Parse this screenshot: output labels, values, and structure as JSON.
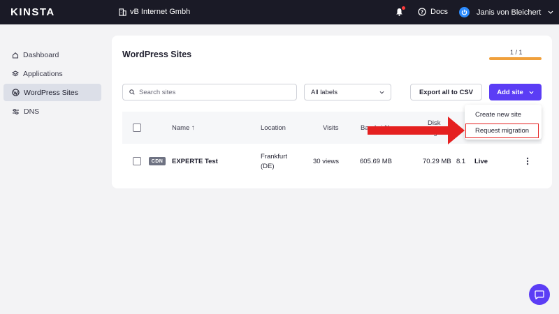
{
  "header": {
    "logo": "KINSTA",
    "company": "vB Internet Gmbh",
    "docs_label": "Docs",
    "user_name": "Janis von Bleichert"
  },
  "sidebar": {
    "items": [
      {
        "label": "Dashboard",
        "icon": "home-icon",
        "active": false
      },
      {
        "label": "Applications",
        "icon": "layers-icon",
        "active": false
      },
      {
        "label": "WordPress Sites",
        "icon": "wordpress-icon",
        "active": true
      },
      {
        "label": "DNS",
        "icon": "sliders-icon",
        "active": false
      }
    ]
  },
  "main": {
    "title": "WordPress Sites",
    "pager": "1 / 1",
    "search_placeholder": "Search sites",
    "labels_select": "All labels",
    "export_label": "Export all to CSV",
    "add_site_label": "Add site",
    "table": {
      "headers": {
        "name": "Name ↑",
        "location": "Location",
        "visits": "Visits",
        "bandwidth": "Bandwidth",
        "disk": "Disk",
        "disk_sub": "usage"
      },
      "rows": [
        {
          "badge": "CDN",
          "name": "EXPERTE Test",
          "location_line1": "Frankfurt",
          "location_line2": "(DE)",
          "visits": "30 views",
          "bandwidth": "605.69 MB",
          "disk": "70.29 MB",
          "php": "8.1",
          "status": "Live"
        }
      ]
    },
    "add_site_menu": {
      "items": [
        "Create new site",
        "Request migration"
      ]
    }
  },
  "colors": {
    "topbar": "#1a1a26",
    "accent": "#5b3df5",
    "progress": "#f0a03c",
    "annotation": "#e52020"
  }
}
